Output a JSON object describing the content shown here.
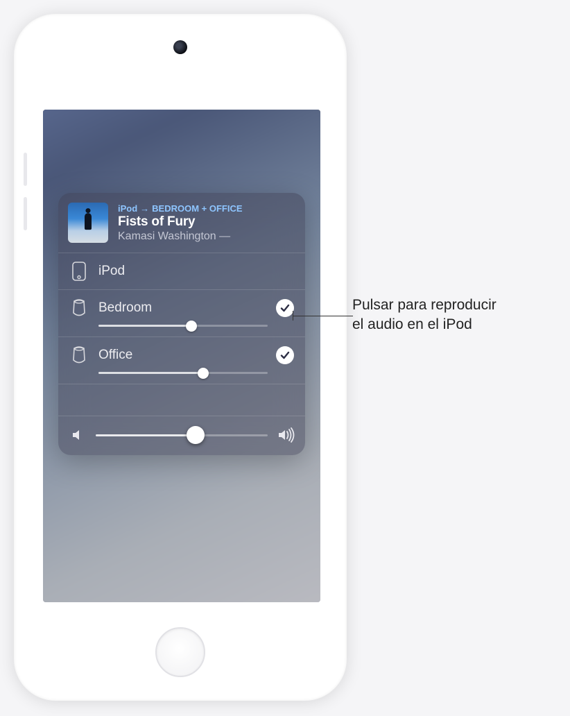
{
  "route": {
    "from": "iPod",
    "arrow": "→",
    "to": "BEDROOM + OFFICE"
  },
  "now_playing": {
    "title": "Fists of Fury",
    "artist": "Kamasi Washington —"
  },
  "devices": [
    {
      "name": "iPod",
      "kind": "ipod",
      "selected": false,
      "has_slider": false
    },
    {
      "name": "Bedroom",
      "kind": "homepod",
      "selected": true,
      "has_slider": true,
      "volume_pct": 55
    },
    {
      "name": "Office",
      "kind": "homepod",
      "selected": true,
      "has_slider": true,
      "volume_pct": 62
    }
  ],
  "master_volume_pct": 58,
  "callout": {
    "line1": "Pulsar para reproducir",
    "line2": "el audio en el iPod"
  }
}
